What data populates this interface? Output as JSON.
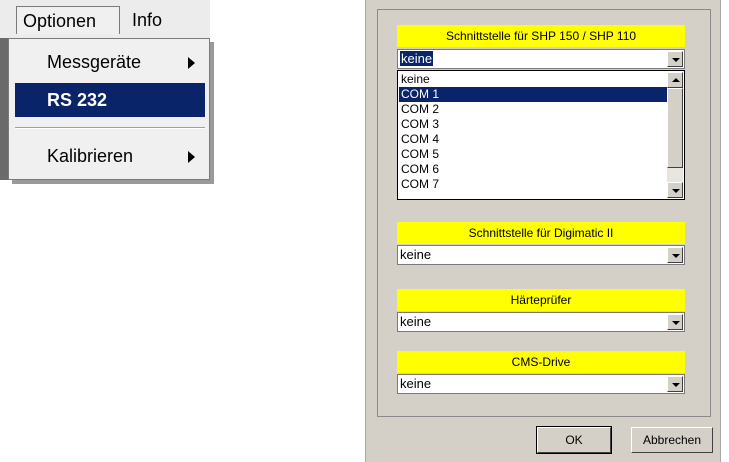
{
  "menubar": {
    "items": [
      {
        "label": "Optionen"
      },
      {
        "label": "Info"
      }
    ]
  },
  "options_menu": {
    "items": [
      {
        "label": "Messgeräte",
        "submenu": true
      },
      {
        "label": "RS 232",
        "selected": true
      },
      {
        "label": "Kalibrieren",
        "submenu": true
      }
    ]
  },
  "dialog": {
    "sections": [
      {
        "title": "Schnittstelle für SHP 150 / SHP 110",
        "value": "keine"
      },
      {
        "title": "Schnittstelle für Digimatic II",
        "value": "keine"
      },
      {
        "title": "Härteprüfer",
        "value": "keine"
      },
      {
        "title": "CMS-Drive",
        "value": "keine"
      }
    ],
    "dropdown_list": {
      "options": [
        "keine",
        "COM 1",
        "COM 2",
        "COM 3",
        "COM 4",
        "COM 5",
        "COM 6",
        "COM 7"
      ],
      "highlighted": "COM 1"
    },
    "ok_label": "OK",
    "cancel_label": "Abbrechen"
  },
  "colors": {
    "section_header": "#ffff00",
    "selection": "#0a246a",
    "dialog_face": "#d4d0c8"
  }
}
